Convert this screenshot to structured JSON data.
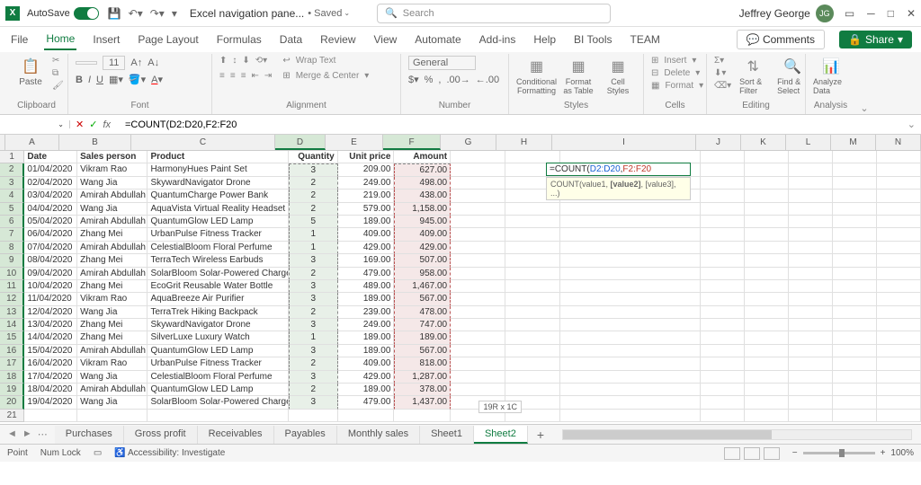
{
  "title": {
    "autosave": "AutoSave",
    "filename": "Excel navigation pane...",
    "saved": "• Saved",
    "search_placeholder": "Search",
    "user": "Jeffrey George",
    "initials": "JG"
  },
  "tabs": {
    "file": "File",
    "home": "Home",
    "insert": "Insert",
    "page_layout": "Page Layout",
    "formulas": "Formulas",
    "data": "Data",
    "review": "Review",
    "view": "View",
    "automate": "Automate",
    "addins": "Add-ins",
    "help": "Help",
    "bitools": "BI Tools",
    "team": "TEAM",
    "comments": "Comments",
    "share": "Share"
  },
  "ribbon": {
    "clipboard": {
      "paste": "Paste",
      "label": "Clipboard"
    },
    "font": {
      "label": "Font",
      "name": "",
      "size": "11"
    },
    "alignment": {
      "label": "Alignment",
      "wrap": "Wrap Text",
      "merge": "Merge & Center"
    },
    "number": {
      "label": "Number",
      "format": "General"
    },
    "styles": {
      "label": "Styles",
      "cond": "Conditional Formatting",
      "table": "Format as Table",
      "cell": "Cell Styles"
    },
    "cells": {
      "label": "Cells",
      "insert": "Insert",
      "delete": "Delete",
      "format": "Format"
    },
    "editing": {
      "label": "Editing",
      "sort": "Sort & Filter",
      "find": "Find & Select"
    },
    "analysis": {
      "label": "Analysis",
      "analyze": "Analyze Data"
    }
  },
  "namebox": "",
  "formula": "=COUNT(D2:D20,F2:F20",
  "floating": {
    "text": "=COUNT(",
    "r1": "D2:D20",
    "sep": ",",
    "r2": "F2:F20",
    "hint": "COUNT(value1, [value2], [value3], ...)"
  },
  "size_hint": "19R x 1C",
  "columns": [
    "A",
    "B",
    "C",
    "D",
    "E",
    "F",
    "G",
    "H",
    "I",
    "J",
    "K",
    "L",
    "M",
    "N"
  ],
  "headers": {
    "date": "Date",
    "person": "Sales person",
    "product": "Product",
    "qty": "Quantity",
    "price": "Unit price",
    "amount": "Amount"
  },
  "rows": [
    {
      "r": 2,
      "date": "01/04/2020",
      "person": "Vikram Rao",
      "product": "HarmonyHues Paint Set",
      "qty": "3",
      "price": "209.00",
      "amount": "627.00"
    },
    {
      "r": 3,
      "date": "02/04/2020",
      "person": "Wang Jia",
      "product": "SkywardNavigator Drone",
      "qty": "2",
      "price": "249.00",
      "amount": "498.00"
    },
    {
      "r": 4,
      "date": "03/04/2020",
      "person": "Amirah Abdullah",
      "product": "QuantumCharge Power Bank",
      "qty": "2",
      "price": "219.00",
      "amount": "438.00"
    },
    {
      "r": 5,
      "date": "04/04/2020",
      "person": "Wang Jia",
      "product": "AquaVista Virtual Reality Headset",
      "qty": "2",
      "price": "579.00",
      "amount": "1,158.00"
    },
    {
      "r": 6,
      "date": "05/04/2020",
      "person": "Amirah Abdullah",
      "product": "QuantumGlow LED Lamp",
      "qty": "5",
      "price": "189.00",
      "amount": "945.00"
    },
    {
      "r": 7,
      "date": "06/04/2020",
      "person": "Zhang Mei",
      "product": "UrbanPulse Fitness Tracker",
      "qty": "1",
      "price": "409.00",
      "amount": "409.00"
    },
    {
      "r": 8,
      "date": "07/04/2020",
      "person": "Amirah Abdullah",
      "product": "CelestialBloom Floral Perfume",
      "qty": "1",
      "price": "429.00",
      "amount": "429.00"
    },
    {
      "r": 9,
      "date": "08/04/2020",
      "person": "Zhang Mei",
      "product": "TerraTech Wireless Earbuds",
      "qty": "3",
      "price": "169.00",
      "amount": "507.00"
    },
    {
      "r": 10,
      "date": "09/04/2020",
      "person": "Amirah Abdullah",
      "product": "SolarBloom Solar-Powered Charger",
      "qty": "2",
      "price": "479.00",
      "amount": "958.00"
    },
    {
      "r": 11,
      "date": "10/04/2020",
      "person": "Zhang Mei",
      "product": "EcoGrit Reusable Water Bottle",
      "qty": "3",
      "price": "489.00",
      "amount": "1,467.00"
    },
    {
      "r": 12,
      "date": "11/04/2020",
      "person": "Vikram Rao",
      "product": "AquaBreeze Air Purifier",
      "qty": "3",
      "price": "189.00",
      "amount": "567.00"
    },
    {
      "r": 13,
      "date": "12/04/2020",
      "person": "Wang Jia",
      "product": "TerraTrek Hiking Backpack",
      "qty": "2",
      "price": "239.00",
      "amount": "478.00"
    },
    {
      "r": 14,
      "date": "13/04/2020",
      "person": "Zhang Mei",
      "product": "SkywardNavigator Drone",
      "qty": "3",
      "price": "249.00",
      "amount": "747.00"
    },
    {
      "r": 15,
      "date": "14/04/2020",
      "person": "Zhang Mei",
      "product": "SilverLuxe Luxury Watch",
      "qty": "1",
      "price": "189.00",
      "amount": "189.00"
    },
    {
      "r": 16,
      "date": "15/04/2020",
      "person": "Amirah Abdullah",
      "product": "QuantumGlow LED Lamp",
      "qty": "3",
      "price": "189.00",
      "amount": "567.00"
    },
    {
      "r": 17,
      "date": "16/04/2020",
      "person": "Vikram Rao",
      "product": "UrbanPulse Fitness Tracker",
      "qty": "2",
      "price": "409.00",
      "amount": "818.00"
    },
    {
      "r": 18,
      "date": "17/04/2020",
      "person": "Wang Jia",
      "product": "CelestialBloom Floral Perfume",
      "qty": "3",
      "price": "429.00",
      "amount": "1,287.00"
    },
    {
      "r": 19,
      "date": "18/04/2020",
      "person": "Amirah Abdullah",
      "product": "QuantumGlow LED Lamp",
      "qty": "2",
      "price": "189.00",
      "amount": "378.00"
    },
    {
      "r": 20,
      "date": "19/04/2020",
      "person": "Wang Jia",
      "product": "SolarBloom Solar-Powered Charger",
      "qty": "3",
      "price": "479.00",
      "amount": "1,437.00"
    }
  ],
  "sheets": [
    "Purchases",
    "Gross profit",
    "Receivables",
    "Payables",
    "Monthly sales",
    "Sheet1",
    "Sheet2"
  ],
  "active_sheet": "Sheet2",
  "status": {
    "mode": "Point",
    "numlock": "Num Lock",
    "access": "Accessibility: Investigate",
    "zoom": "100%"
  }
}
